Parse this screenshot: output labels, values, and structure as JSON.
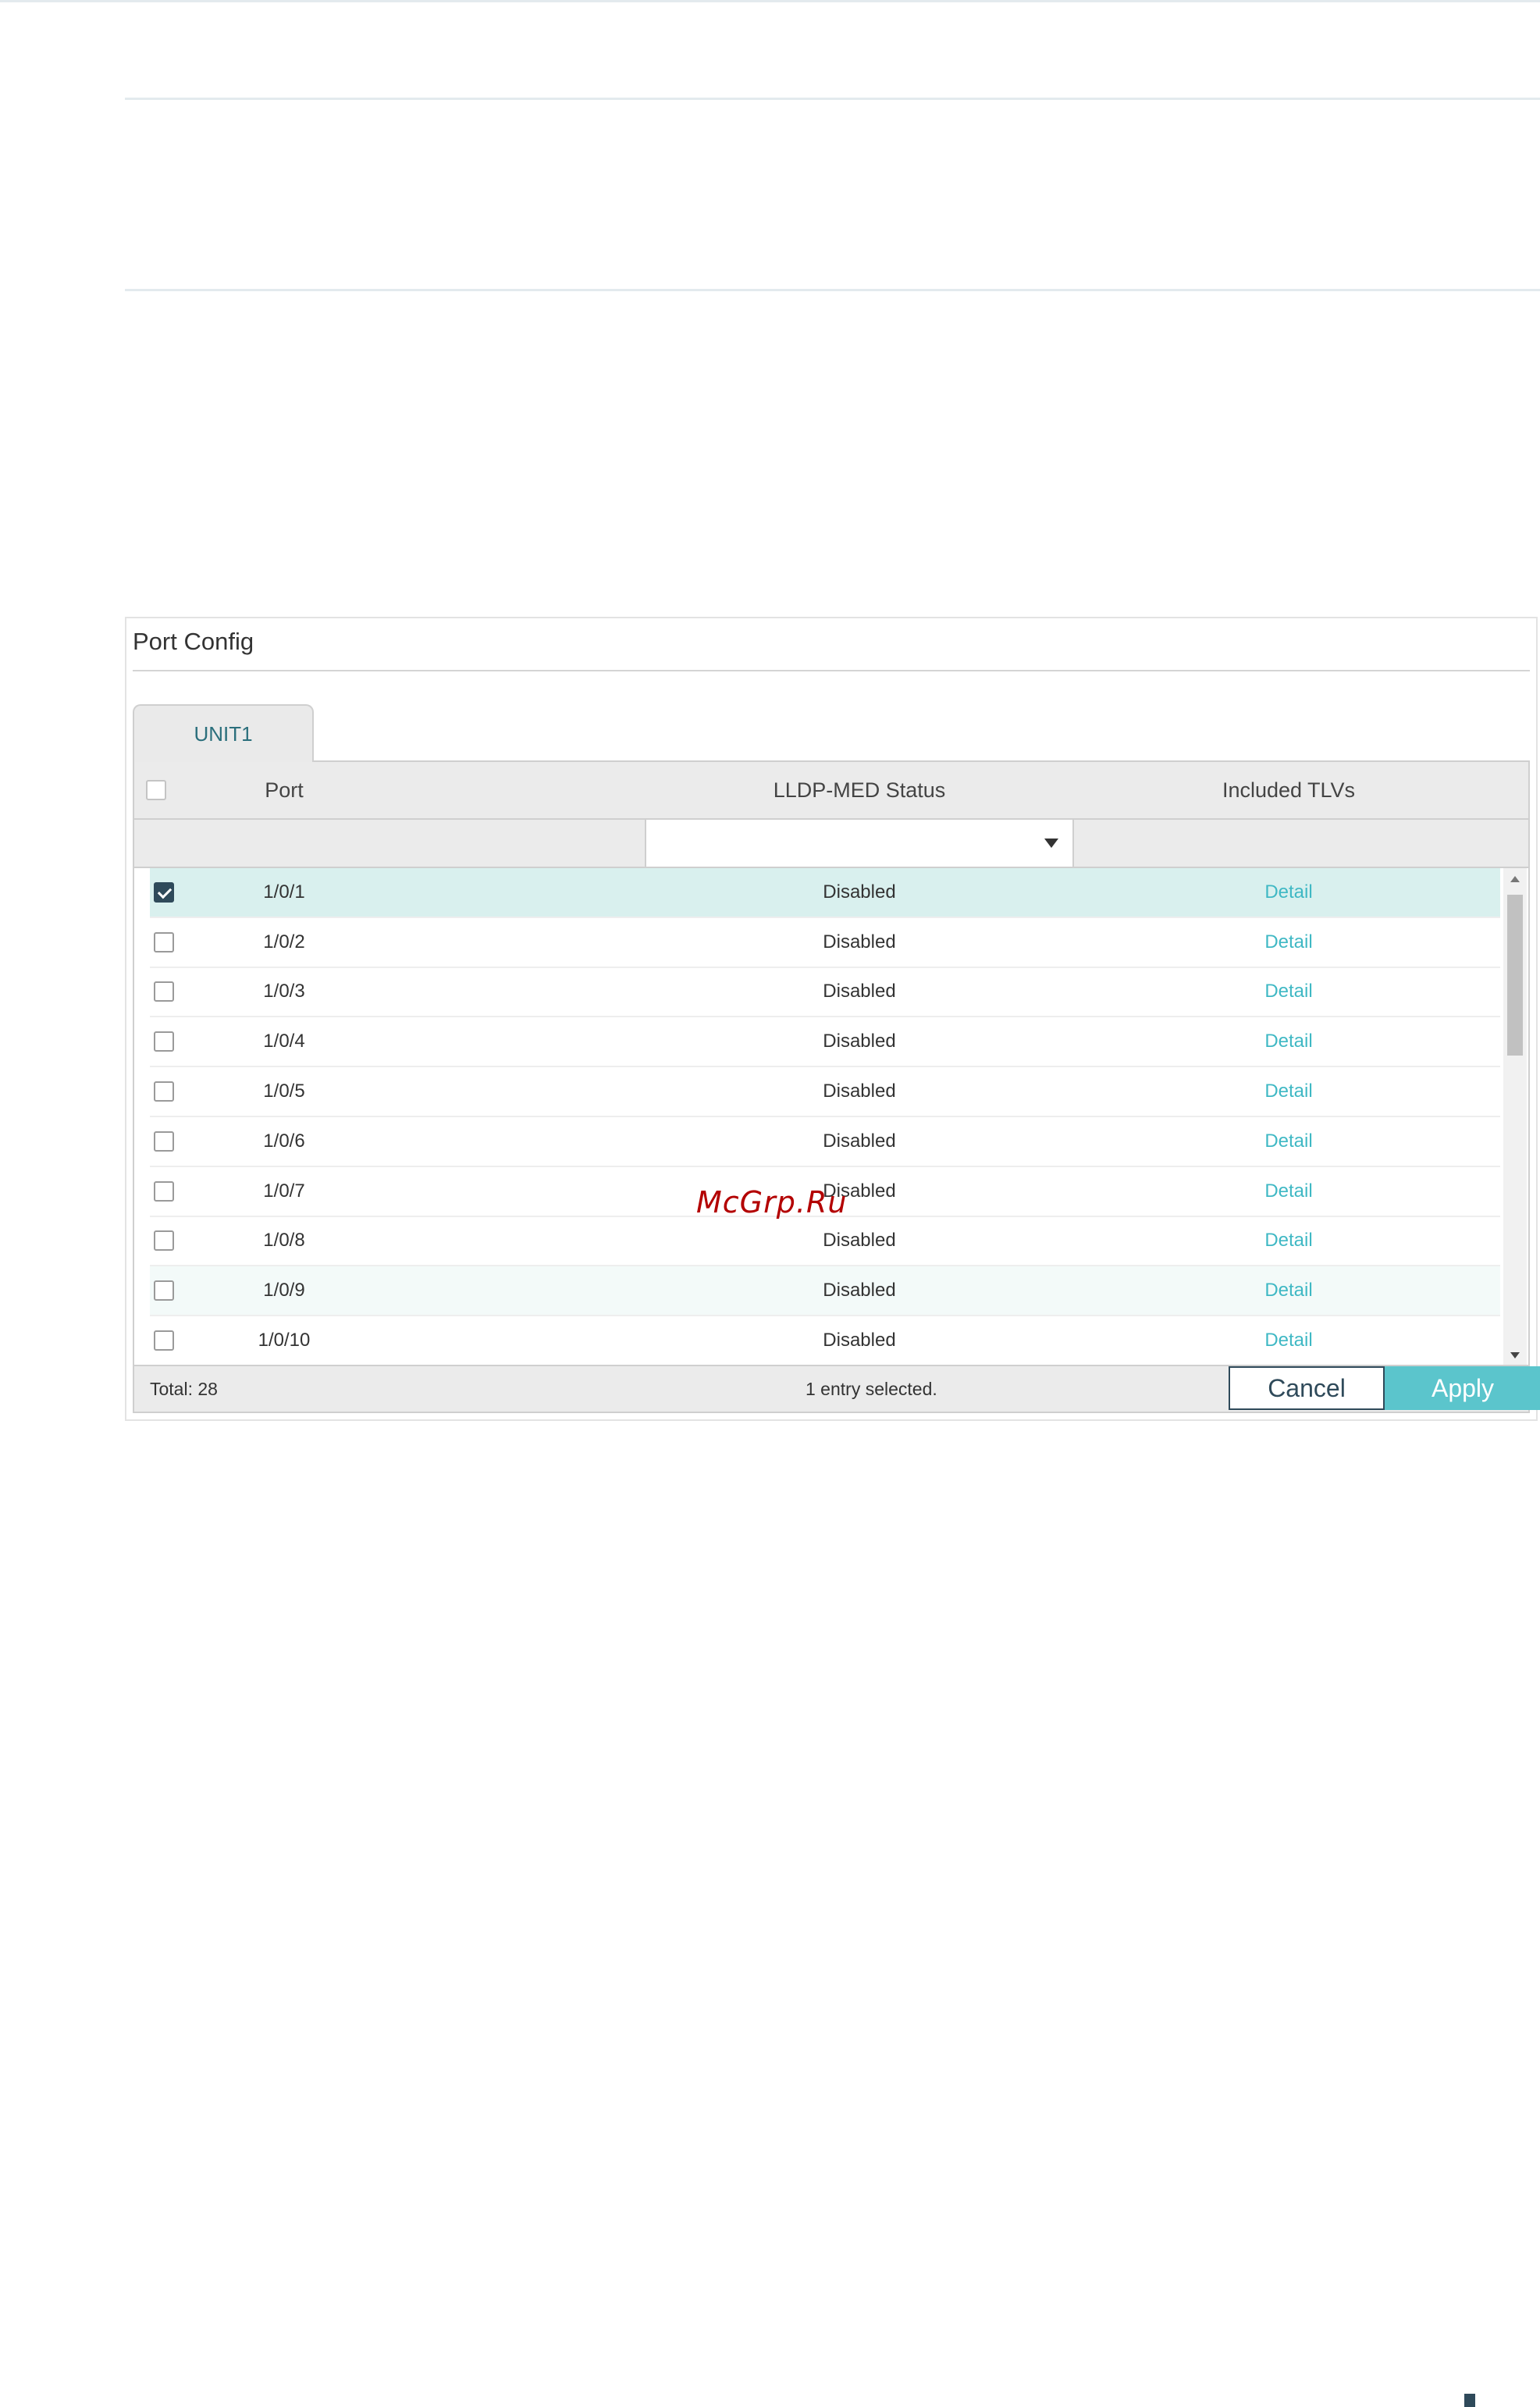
{
  "panel": {
    "title": "Port Config",
    "tab": "UNIT1"
  },
  "table": {
    "columns": [
      "Port",
      "LLDP-MED Status",
      "Included TLVs"
    ],
    "filter": {
      "status_value": ""
    },
    "rows": [
      {
        "port": "1/0/1",
        "status": "Disabled",
        "tlvs": "Detail",
        "checked": true
      },
      {
        "port": "1/0/2",
        "status": "Disabled",
        "tlvs": "Detail",
        "checked": false
      },
      {
        "port": "1/0/3",
        "status": "Disabled",
        "tlvs": "Detail",
        "checked": false
      },
      {
        "port": "1/0/4",
        "status": "Disabled",
        "tlvs": "Detail",
        "checked": false
      },
      {
        "port": "1/0/5",
        "status": "Disabled",
        "tlvs": "Detail",
        "checked": false
      },
      {
        "port": "1/0/6",
        "status": "Disabled",
        "tlvs": "Detail",
        "checked": false
      },
      {
        "port": "1/0/7",
        "status": "Disabled",
        "tlvs": "Detail",
        "checked": false
      },
      {
        "port": "1/0/8",
        "status": "Disabled",
        "tlvs": "Detail",
        "checked": false
      },
      {
        "port": "1/0/9",
        "status": "Disabled",
        "tlvs": "Detail",
        "checked": false
      },
      {
        "port": "1/0/10",
        "status": "Disabled",
        "tlvs": "Detail",
        "checked": false
      }
    ]
  },
  "footer": {
    "total": "Total: 28",
    "selected": "1 entry selected.",
    "cancel_label": "Cancel",
    "apply_label": "Apply"
  },
  "watermark": "McGrp.Ru",
  "colors": {
    "accent": "#5bc5cc",
    "link": "#3fb8c4",
    "selected_row": "#d9f0ee",
    "checkbox_checked": "#2f4a5a"
  }
}
